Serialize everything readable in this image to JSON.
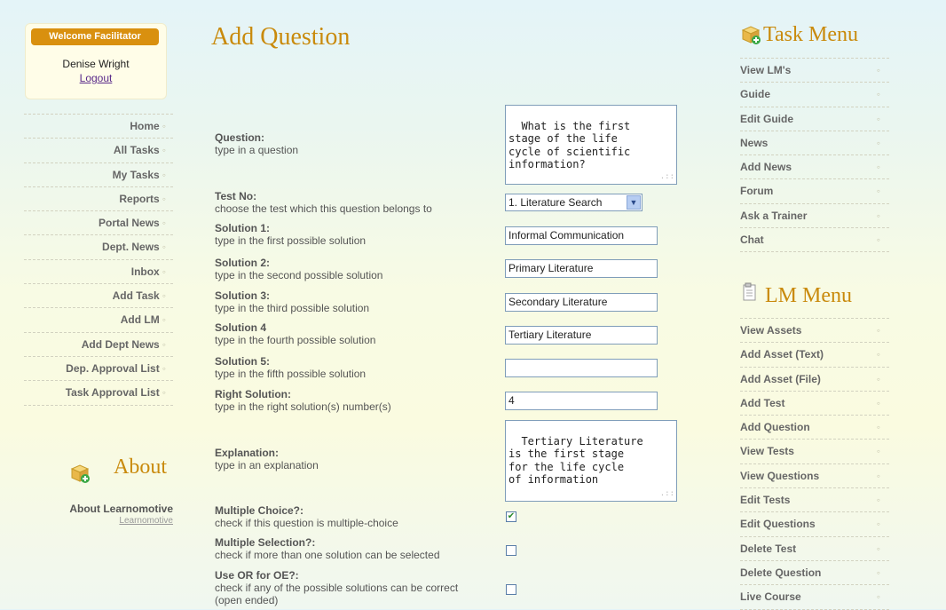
{
  "welcome": {
    "badge": "Welcome Facilitator",
    "name": "Denise Wright",
    "logout": "Logout"
  },
  "left_nav": [
    "Home",
    "All Tasks",
    "My Tasks",
    "Reports",
    "Portal News",
    "Dept. News",
    "Inbox",
    "Add Task",
    "Add LM",
    "Add Dept News",
    "Dep. Approval List",
    "Task Approval List"
  ],
  "about": {
    "title": "About",
    "line1": "About Learnomotive",
    "line2": "Learnomotive"
  },
  "page_title": "Add Question",
  "form": {
    "question": {
      "label": "Question:",
      "desc": "type in a question",
      "value": "What is the first\nstage of the life\ncycle of scientific\ninformation?"
    },
    "test_no": {
      "label": "Test No:",
      "desc": "choose the test which this question belongs to",
      "value": "1. Literature Search"
    },
    "solution1": {
      "label": "Solution 1:",
      "desc": "type in the first possible solution",
      "value": "Informal Communication"
    },
    "solution2": {
      "label": "Solution 2:",
      "desc": "type in the second possible solution",
      "value": "Primary Literature"
    },
    "solution3": {
      "label": "Solution 3:",
      "desc": "type in the third possible solution",
      "value": "Secondary Literature"
    },
    "solution4": {
      "label": "Solution 4",
      "desc": "type in the fourth possible solution",
      "value": "Tertiary Literature"
    },
    "solution5": {
      "label": "Solution 5:",
      "desc": "type in the fifth possible solution",
      "value": ""
    },
    "right_solution": {
      "label": "Right Solution:",
      "desc": "type in the right solution(s) number(s)",
      "value": "4"
    },
    "explanation": {
      "label": "Explanation:",
      "desc": "type in an explanation",
      "value": "Tertiary Literature\nis the first stage\nfor the life cycle\nof information"
    },
    "multiple_choice": {
      "label": "Multiple Choice?:",
      "desc": "check if this question is multiple-choice",
      "checked": "✔"
    },
    "multiple_selection": {
      "label": "Multiple Selection?:",
      "desc": "check if more than one solution can be selected",
      "checked": ""
    },
    "use_or": {
      "label": "Use OR for OE?:",
      "desc": "check if any of the possible solutions can be correct",
      "desc2": "(open ended)",
      "checked": ""
    }
  },
  "task_menu": {
    "title": "Task Menu",
    "items": [
      "View LM's",
      "Guide",
      "Edit Guide",
      "News",
      "Add News",
      "Forum",
      "Ask a Trainer",
      "Chat"
    ]
  },
  "lm_menu": {
    "title": "LM Menu",
    "items": [
      "View Assets",
      "Add Asset (Text)",
      "Add Asset (File)",
      "Add Test",
      "Add Question",
      "View Tests",
      "View Questions",
      "Edit Tests",
      "Edit Questions",
      "Delete Test",
      "Delete Question",
      "Live Course"
    ]
  },
  "colors": {
    "accent": "#c98a0c",
    "badge": "#d9900f"
  }
}
